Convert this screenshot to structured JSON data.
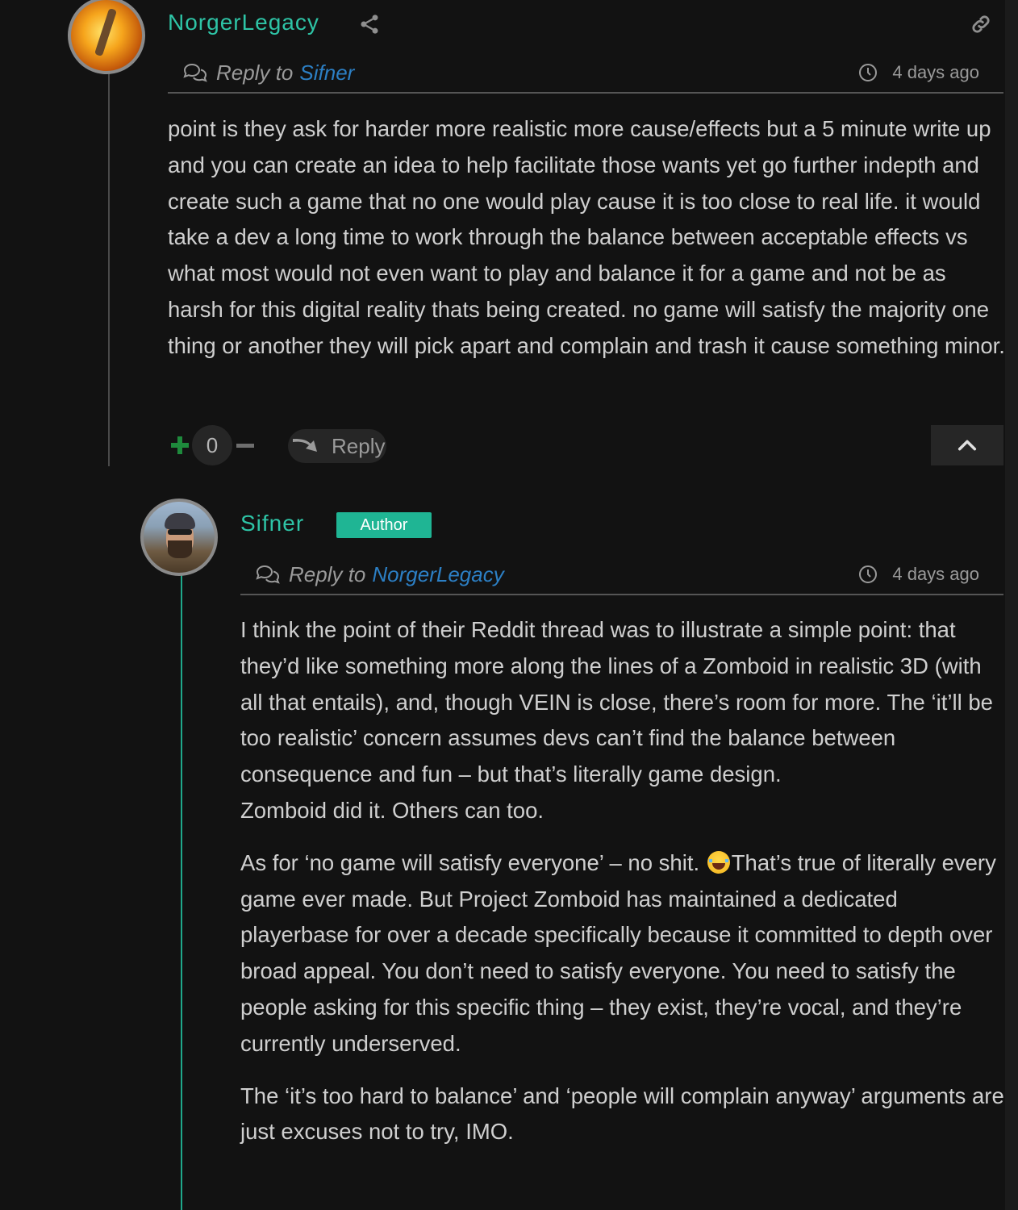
{
  "comment1": {
    "username": "NorgerLegacy",
    "reply_prefix": "Reply to",
    "reply_to": "Sifner",
    "time": "4 days ago",
    "body": "point is they ask for harder more realistic more cause/effects but a 5 minute write up and you can create an idea to help facilitate those wants yet go further indepth and create such a game that no one would play cause it is too close to real life. it would take a dev a long time to work through the balance between acceptable effects vs what most would not even want to play and balance it for a game and not be as harsh for this digital reality thats being created. no game will satisfy the majority one thing or another they will pick apart and complain and trash it cause something minor.",
    "vote_count": "0",
    "reply_label": "Reply"
  },
  "comment2": {
    "username": "Sifner",
    "badge": "Author",
    "reply_prefix": "Reply to",
    "reply_to": "NorgerLegacy",
    "time": "4 days ago",
    "p1": "I think the point of their Reddit thread was to illustrate a simple point: that they’d like something more along the lines of a Zomboid in realistic 3D (with all that entails), and, though VEIN is close, there’s room for more. The ‘it’ll be too realistic’ concern assumes devs can’t find the balance between consequence and fun – but that’s literally game design.",
    "p1b": "Zomboid did it. Others can too.",
    "p2a": "As for ‘no game will satisfy everyone’ – no shit.",
    "p2_emoji": "face-with-tears-of-joy",
    "p2b": "That’s true of literally every game ever made. But Project Zomboid has maintained a dedicated playerbase for over a decade specifically because it committed to depth over broad appeal. You don’t need to satisfy everyone. You need to satisfy the people asking for this specific thing – they exist, they’re vocal, and they’re currently underserved.",
    "p3": "The ‘it’s too hard to balance’ and ‘people will complain anyway’ arguments are just excuses not to try, IMO."
  },
  "colors": {
    "background": "#121212",
    "username": "#2ec4a6",
    "link": "#2c7fc4",
    "author_badge": "#1fb594",
    "upvote": "#1e8a3c"
  },
  "icons": [
    "share-icon",
    "link-icon",
    "chat-icon",
    "clock-icon",
    "plus-icon",
    "minus-icon",
    "reply-arrow-icon",
    "chevron-up-icon"
  ]
}
